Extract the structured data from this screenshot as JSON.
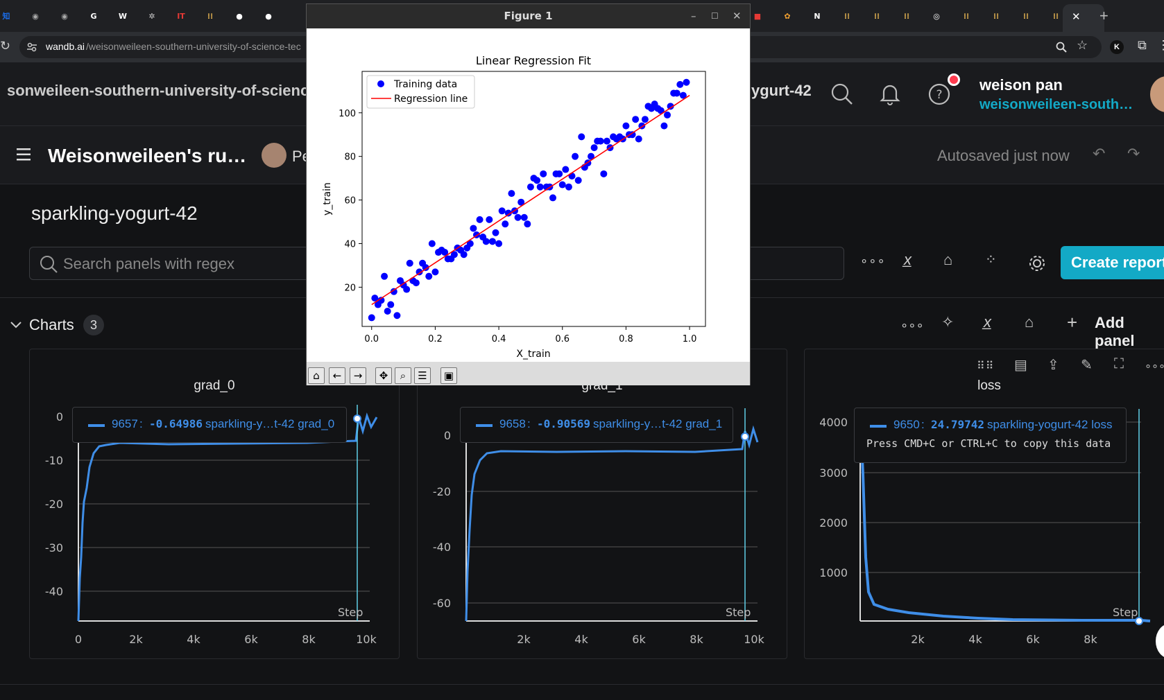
{
  "browser": {
    "url_domain": "wandb.ai",
    "url_path": "/weisonweileen-southern-university-of-science-tec",
    "tab_icons": [
      {
        "glyph": "知",
        "color": "#1a6ce8"
      },
      {
        "glyph": "◉",
        "color": "#aaaaaa"
      },
      {
        "glyph": "◉",
        "color": "#aaaaaa"
      },
      {
        "glyph": "G",
        "color": "#ffffff"
      },
      {
        "glyph": "W",
        "color": "#ffffff"
      },
      {
        "glyph": "✲",
        "color": "#cccccc"
      },
      {
        "glyph": "IT",
        "color": "#e53935"
      },
      {
        "glyph": "⁞⁞",
        "color": "#e0b050"
      },
      {
        "glyph": "●",
        "color": "#ffffff"
      },
      {
        "glyph": "●",
        "color": "#ffffff"
      }
    ],
    "tab_icons_right": [
      {
        "glyph": "■",
        "color": "#e53935"
      },
      {
        "glyph": "✿",
        "color": "#f0a030"
      },
      {
        "glyph": "N",
        "color": "#ffffff"
      },
      {
        "glyph": "⁞⁞",
        "color": "#e0b050"
      },
      {
        "glyph": "⁞⁞",
        "color": "#e0b050"
      },
      {
        "glyph": "⁞⁞",
        "color": "#e0b050"
      },
      {
        "glyph": "◎",
        "color": "#ffffff"
      },
      {
        "glyph": "⁞⁞",
        "color": "#e0b050"
      },
      {
        "glyph": "⁞⁞",
        "color": "#e0b050"
      },
      {
        "glyph": "⁞⁞",
        "color": "#e0b050"
      },
      {
        "glyph": "⁞⁞",
        "color": "#e0b050"
      }
    ],
    "close_tab": "✕",
    "new_tab": "+"
  },
  "header": {
    "breadcrumb": "sonweileen-southern-university-of-scienc",
    "run_crumb": "ygurt-42",
    "user_name": "weison pan",
    "user_org": "weisonweileen-south…"
  },
  "run": {
    "title": "Weisonweileen's ru…",
    "collab_initial": "Pe",
    "autosave": "Autosaved just now",
    "name": "sparkling-yogurt-42"
  },
  "toolbar": {
    "search_placeholder": "Search panels with regex",
    "create_report": "Create report"
  },
  "section": {
    "title": "Charts",
    "count": "3",
    "add_panel": "Add panel"
  },
  "panels": [
    {
      "title": "grad_0",
      "tooltip": {
        "step": "9657",
        "value": "-0.64986",
        "label": "sparkling-y…t-42 grad_0"
      },
      "x_ticks": [
        "0",
        "2k",
        "4k",
        "6k",
        "8k",
        "10k"
      ],
      "y_ticks": [
        "0",
        "-10",
        "-20",
        "-30",
        "-40"
      ],
      "step_label": "Step"
    },
    {
      "title": "grad_1",
      "tooltip": {
        "step": "9658",
        "value": "-0.90569",
        "label": "sparkling-y…t-42 grad_1"
      },
      "x_ticks": [
        "2k",
        "4k",
        "6k",
        "8k",
        "10k"
      ],
      "y_ticks": [
        "0",
        "-20",
        "-40",
        "-60"
      ],
      "step_label": "Step"
    },
    {
      "title": "loss",
      "tooltip": {
        "step": "9650",
        "value": "24.79742",
        "label": "sparkling-yogurt-42 loss",
        "hint": "Press CMD+C or CTRL+C to copy this data"
      },
      "x_ticks": [
        "2k",
        "4k",
        "6k",
        "8k"
      ],
      "y_ticks": [
        "4000",
        "3000",
        "2000",
        "1000"
      ],
      "step_label": "Step"
    }
  ],
  "figure": {
    "window_title": "Figure 1",
    "minimize": "–",
    "maximize": "☐",
    "close": "✕",
    "toolbar_icons": [
      "home-icon",
      "back-icon",
      "forward-icon",
      "pan-icon",
      "zoom-icon",
      "configure-icon",
      "save-icon"
    ]
  },
  "chart_data": {
    "type": "scatter",
    "title": "Linear Regression Fit",
    "xlabel": "X_train",
    "ylabel": "y_train",
    "xlim": [
      -0.03,
      1.05
    ],
    "ylim": [
      2,
      119
    ],
    "x_ticks": [
      0.0,
      0.2,
      0.4,
      0.6,
      0.8,
      1.0
    ],
    "x_tick_labels": [
      "0.0",
      "0.2",
      "0.4",
      "0.6",
      "0.8",
      "1.0"
    ],
    "y_ticks": [
      20,
      40,
      60,
      80,
      100
    ],
    "legend_position": "top-left",
    "series": [
      {
        "name": "Training data",
        "kind": "scatter",
        "color": "#0000ff",
        "points": [
          [
            0.0,
            6
          ],
          [
            0.01,
            15
          ],
          [
            0.02,
            12
          ],
          [
            0.03,
            14
          ],
          [
            0.04,
            25
          ],
          [
            0.05,
            9
          ],
          [
            0.06,
            12
          ],
          [
            0.07,
            18
          ],
          [
            0.08,
            7
          ],
          [
            0.09,
            23
          ],
          [
            0.1,
            21
          ],
          [
            0.11,
            19
          ],
          [
            0.12,
            31
          ],
          [
            0.13,
            23
          ],
          [
            0.14,
            22
          ],
          [
            0.15,
            27
          ],
          [
            0.16,
            31
          ],
          [
            0.17,
            29
          ],
          [
            0.18,
            25
          ],
          [
            0.19,
            40
          ],
          [
            0.2,
            27
          ],
          [
            0.21,
            36
          ],
          [
            0.22,
            37
          ],
          [
            0.23,
            36
          ],
          [
            0.24,
            33
          ],
          [
            0.25,
            33
          ],
          [
            0.26,
            35
          ],
          [
            0.27,
            38
          ],
          [
            0.28,
            37
          ],
          [
            0.29,
            35
          ],
          [
            0.3,
            38
          ],
          [
            0.31,
            40
          ],
          [
            0.32,
            47
          ],
          [
            0.33,
            44
          ],
          [
            0.34,
            51
          ],
          [
            0.35,
            43
          ],
          [
            0.36,
            41
          ],
          [
            0.37,
            51
          ],
          [
            0.38,
            41
          ],
          [
            0.39,
            45
          ],
          [
            0.4,
            40
          ],
          [
            0.41,
            55
          ],
          [
            0.42,
            49
          ],
          [
            0.43,
            54
          ],
          [
            0.44,
            63
          ],
          [
            0.45,
            55
          ],
          [
            0.46,
            52
          ],
          [
            0.47,
            59
          ],
          [
            0.48,
            52
          ],
          [
            0.49,
            49
          ],
          [
            0.5,
            66
          ],
          [
            0.51,
            70
          ],
          [
            0.52,
            69
          ],
          [
            0.53,
            66
          ],
          [
            0.54,
            72
          ],
          [
            0.55,
            66
          ],
          [
            0.56,
            66
          ],
          [
            0.57,
            61
          ],
          [
            0.58,
            72
          ],
          [
            0.59,
            72
          ],
          [
            0.6,
            67
          ],
          [
            0.61,
            74
          ],
          [
            0.62,
            66
          ],
          [
            0.63,
            71
          ],
          [
            0.64,
            80
          ],
          [
            0.65,
            69
          ],
          [
            0.66,
            89
          ],
          [
            0.67,
            75
          ],
          [
            0.68,
            77
          ],
          [
            0.69,
            80
          ],
          [
            0.7,
            84
          ],
          [
            0.71,
            87
          ],
          [
            0.72,
            87
          ],
          [
            0.73,
            72
          ],
          [
            0.74,
            87
          ],
          [
            0.75,
            84
          ],
          [
            0.76,
            89
          ],
          [
            0.77,
            88
          ],
          [
            0.78,
            89
          ],
          [
            0.79,
            88
          ],
          [
            0.8,
            94
          ],
          [
            0.81,
            90
          ],
          [
            0.82,
            90
          ],
          [
            0.83,
            97
          ],
          [
            0.84,
            88
          ],
          [
            0.85,
            94
          ],
          [
            0.86,
            97
          ],
          [
            0.87,
            103
          ],
          [
            0.88,
            102
          ],
          [
            0.89,
            104
          ],
          [
            0.9,
            102
          ],
          [
            0.91,
            101
          ],
          [
            0.92,
            94
          ],
          [
            0.93,
            99
          ],
          [
            0.94,
            103
          ],
          [
            0.95,
            109
          ],
          [
            0.96,
            109
          ],
          [
            0.97,
            113
          ],
          [
            0.98,
            108
          ],
          [
            0.99,
            114
          ]
        ]
      },
      {
        "name": "Regression line",
        "kind": "line",
        "color": "#ff0000",
        "points": [
          [
            0.0,
            12
          ],
          [
            1.0,
            108
          ]
        ]
      }
    ]
  }
}
